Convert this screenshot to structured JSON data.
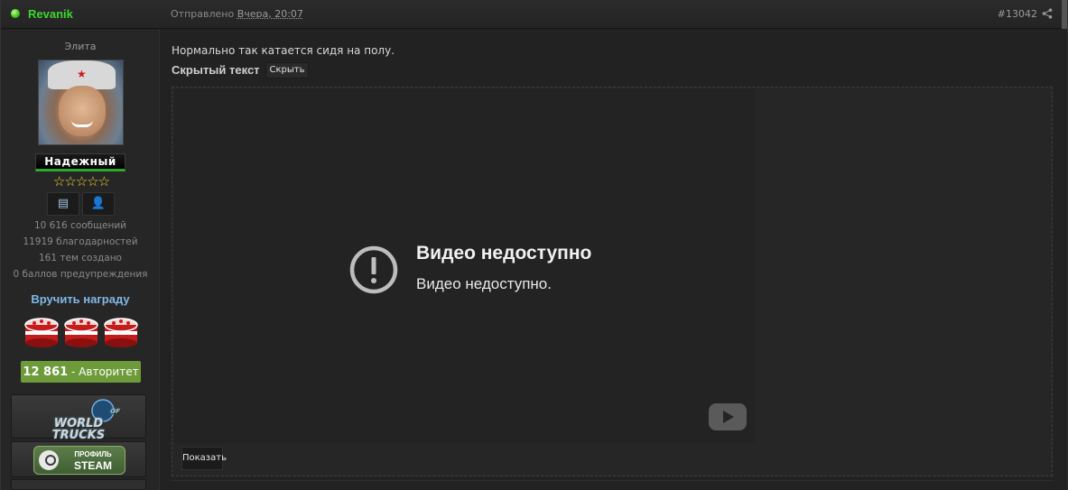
{
  "header": {
    "author": "Revanik",
    "sent_prefix": "Отправлено",
    "sent_time": "Вчера, 20:07",
    "post_number": "#13042"
  },
  "user": {
    "title": "Элита",
    "rank": "Надежный",
    "stars": "☆☆☆☆☆",
    "stats": {
      "messages": "10 616 сообщений",
      "thanks": "11919 благодарностей",
      "topics": "161 тем создано",
      "warnings": "0 баллов предупреждения"
    },
    "award_link": "Вручить награду",
    "reputation_value": "12 861",
    "reputation_label": "Авторитет",
    "wot_banner_main": "WORLD TRUCKS",
    "wot_banner_of": "OF",
    "steam_line1": "ПРОФИЛЬ",
    "steam_line2": "STEAM"
  },
  "content": {
    "message": "Нормально так катается сидя на полу.",
    "hidden_title": "Скрытый текст",
    "hide_button": "Скрыть",
    "show_button": "Показать",
    "video_title": "Видео недоступно",
    "video_subtitle": "Видео недоступно."
  },
  "colors": {
    "author": "#3dd62a",
    "award_link": "#7fb8e6",
    "reputation_bg": "#6e9b3a"
  }
}
